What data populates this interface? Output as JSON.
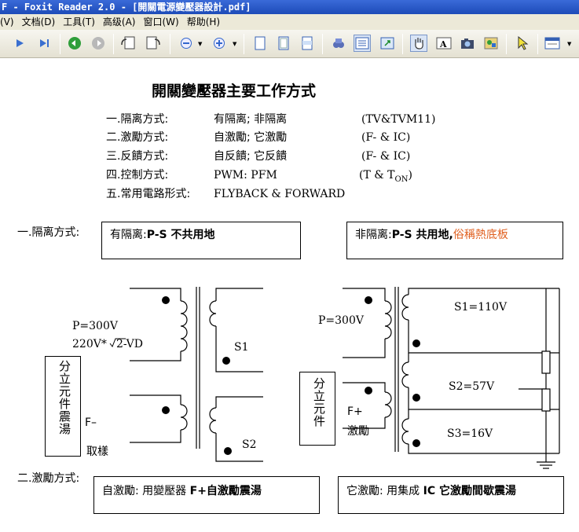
{
  "window": {
    "title": "F - Foxit Reader 2.0 - [開關電源變壓器設計.pdf]"
  },
  "menu": [
    "(V)",
    "文档(D)",
    "工具(T)",
    "高级(A)",
    "窗口(W)",
    "帮助(H)"
  ],
  "toolbar": {
    "icons": [
      "play-icon",
      "last-page-icon",
      "back-icon",
      "forward-icon",
      "rotate-left-icon",
      "rotate-right-icon",
      "zoom-out-icon",
      "zoom-in-icon",
      "actual-size-icon",
      "fit-page-icon",
      "fit-width-icon",
      "find-icon",
      "continuous-icon",
      "fullscreen-icon",
      "hand-tool-icon",
      "text-select-icon",
      "snapshot-icon",
      "image-tool-icon",
      "select-arrow-icon",
      "annotation-icon"
    ]
  },
  "doc": {
    "heading": "開關變壓器主要工作方式",
    "list": [
      {
        "label": "一.隔离方式:",
        "value": "有隔离; 非隔离",
        "note": "(TV&TVM11)"
      },
      {
        "label": "二.激勵方式:",
        "value": "自激勵; 它激勵",
        "note": "(F- & IC)"
      },
      {
        "label": "三.反饋方式:",
        "value": "自反饋;   它反饋",
        "note": "(F- & IC)"
      },
      {
        "label": "四.控制方式:",
        "value": "PWM:       PFM",
        "note_main": "(T & T",
        "note_sub": "ON",
        "note_end": ")"
      },
      {
        "label": "五.常用電路形式:",
        "value": "FLYBACK & FORWARD"
      }
    ],
    "section1": {
      "label": "一.隔离方式:",
      "box1": {
        "prefix": "有隔离:",
        "bold": "P-S 不共用地"
      },
      "box2": {
        "prefix": "非隔离:",
        "bold": "P-S 共用地,",
        "accent": "俗稱熱底板",
        "accent_color": "#e06020"
      }
    },
    "circuit_left": {
      "p_label": "P=300V",
      "v_label_a": "220V*",
      "v_label_b": "2-VD",
      "vbox": "分立元件震湯",
      "f_label": "F–",
      "sample_label": "取樣",
      "s1": "S1",
      "s2": "S2"
    },
    "circuit_right": {
      "p_label": "P=300V",
      "vbox": "分立元件",
      "f_label": "F+",
      "excite_label": "激勵",
      "s1": "S1=110V",
      "s2": "S2=57V",
      "s3": "S3=16V"
    },
    "section2": {
      "label": "二.激勵方式:",
      "box1": {
        "prefix": "自激勵: 用變壓器 ",
        "bold": "F+自激勵震湯"
      },
      "box2": {
        "prefix": "它激勵: 用集成 ",
        "bold": "IC 它激勵間歇震湯"
      }
    }
  }
}
